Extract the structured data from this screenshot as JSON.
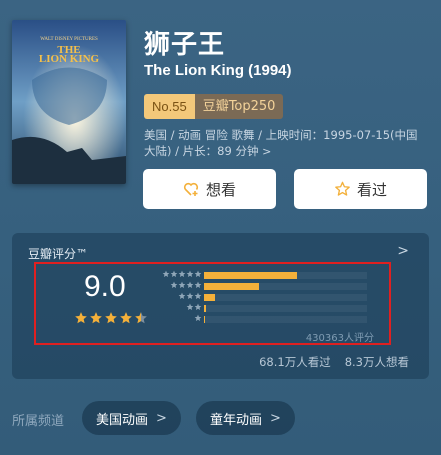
{
  "movie": {
    "title": "狮子王",
    "original_title": "The Lion King (1994)",
    "rank_no": "No.55",
    "rank_list": "豆瓣Top250",
    "meta_line1": "美国 / 动画 冒险 歌舞 / 上映时间：1995-07-15(中国",
    "meta_line2": "大陆) / 片长：89 分钟",
    "poster_logo": "LION KING"
  },
  "actions": {
    "want_label": "想看",
    "seen_label": "看过"
  },
  "rating": {
    "header": "豆瓣评分™",
    "score": "9.0",
    "stars": 4.5,
    "distribution": [
      {
        "stars": 5,
        "fraction": 0.57
      },
      {
        "stars": 4,
        "fraction": 0.34
      },
      {
        "stars": 3,
        "fraction": 0.07
      },
      {
        "stars": 2,
        "fraction": 0.01
      },
      {
        "stars": 1,
        "fraction": 0.005
      }
    ],
    "votes": "430363人评分",
    "seen_count": "68.1万人看过",
    "want_count": "8.3万人想看"
  },
  "channels": {
    "label": "所属频道",
    "items": [
      "美国动画",
      "童年动画"
    ]
  },
  "colors": {
    "star": "#f3b03a",
    "highlight_border": "#e02020",
    "rank_bg": "#f3c87a"
  }
}
